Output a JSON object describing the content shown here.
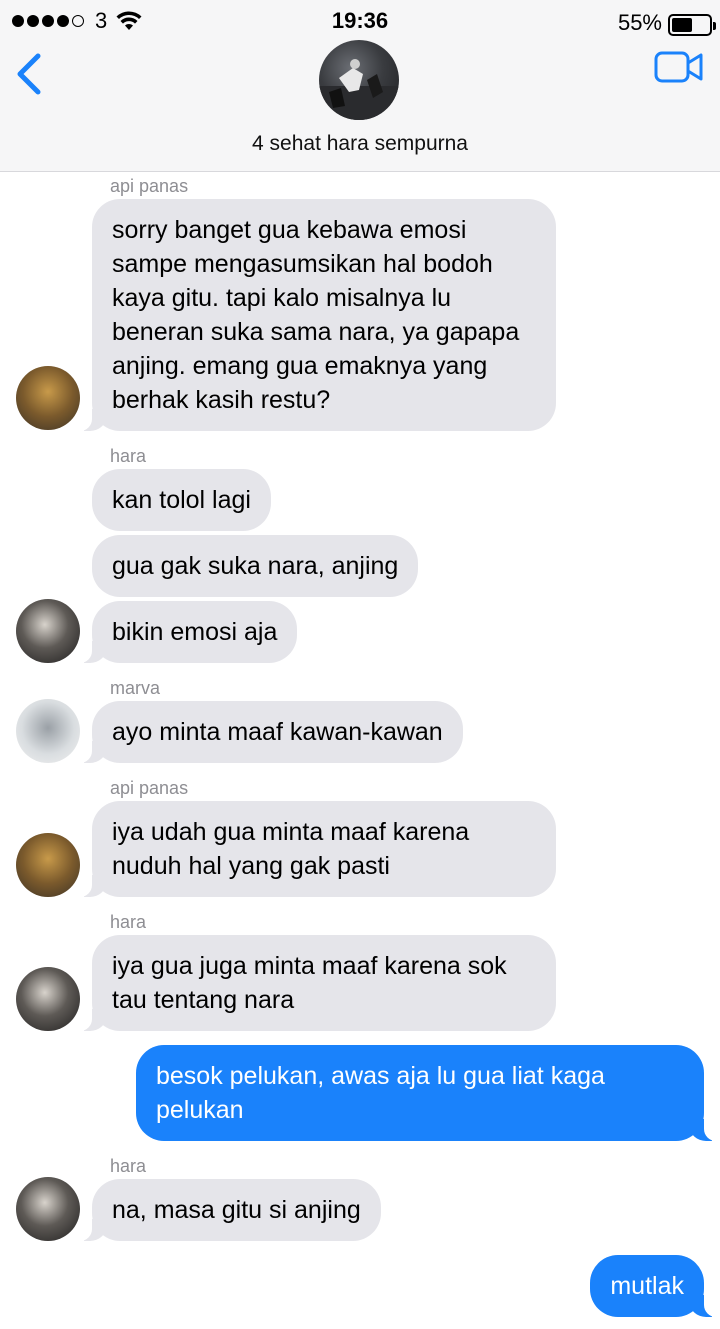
{
  "status_bar": {
    "carrier": "3",
    "time": "19:36",
    "battery_percent": "55%",
    "battery_level": 0.55
  },
  "header": {
    "group_name": "4 sehat hara sempurna",
    "back_icon": "chevron-left-icon",
    "video_icon": "video-camera-icon"
  },
  "colors": {
    "accent": "#1a82fb",
    "incoming_bubble": "#e5e5ea"
  },
  "messages": [
    {
      "sender": "api panas",
      "lines": [
        "sorry banget gua kebawa emosi",
        "sampe mengasumsikan hal bodoh",
        "kaya gitu. tapi kalo misalnya lu",
        "beneran suka sama nara, ya gapapa",
        "anjing. emang gua emaknya yang",
        "berhak kasih restu?"
      ]
    },
    {
      "sender": "hara",
      "lines": [
        "kan tolol lagi"
      ]
    },
    {
      "lines": [
        "gua gak suka nara, anjing"
      ]
    },
    {
      "lines": [
        "bikin emosi aja"
      ]
    },
    {
      "sender": "marva",
      "lines": [
        "ayo minta maaf kawan-kawan"
      ]
    },
    {
      "sender": "api panas",
      "lines": [
        "iya udah gua minta maaf karena",
        "nuduh hal yang gak pasti"
      ]
    },
    {
      "sender": "hara",
      "lines": [
        "iya gua juga minta maaf karena sok",
        "tau tentang nara"
      ]
    },
    {
      "lines": [
        "besok pelukan, awas aja lu gua liat kaga",
        "pelukan"
      ]
    },
    {
      "sender": "hara",
      "lines": [
        "na, masa gitu si anjing"
      ]
    },
    {
      "lines": [
        "mutlak"
      ]
    }
  ]
}
